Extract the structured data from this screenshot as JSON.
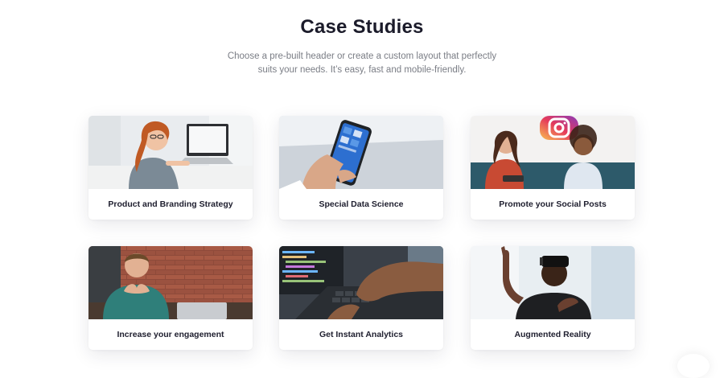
{
  "section": {
    "title": "Case Studies",
    "subtitle_line1": "Choose a pre-built header or create a custom layout that perfectly",
    "subtitle_line2": "suits your needs. It’s easy, fast and mobile-friendly."
  },
  "cards": [
    {
      "label": "Product and Branding Strategy"
    },
    {
      "label": "Special Data Science"
    },
    {
      "label": "Promote your Social Posts"
    },
    {
      "label": "Increase your engagement"
    },
    {
      "label": "Get Instant Analytics"
    },
    {
      "label": "Augmented Reality"
    }
  ]
}
